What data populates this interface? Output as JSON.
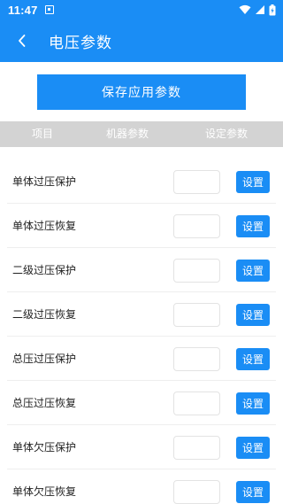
{
  "status_bar": {
    "time": "11:47",
    "icons": [
      "notification-icon",
      "wifi-icon",
      "signal-icon",
      "battery-charging-icon"
    ]
  },
  "app_bar": {
    "back_icon": "chevron-left-icon",
    "title": "电压参数"
  },
  "save_button": {
    "label": "保存应用参数"
  },
  "table": {
    "headers": [
      "项目",
      "机器参数",
      "设定参数"
    ],
    "rows": [
      {
        "label": "单体过压保护",
        "machine_value": "",
        "set_value": "",
        "button": "设置"
      },
      {
        "label": "单体过压恢复",
        "machine_value": "",
        "set_value": "",
        "button": "设置"
      },
      {
        "label": "二级过压保护",
        "machine_value": "",
        "set_value": "",
        "button": "设置"
      },
      {
        "label": "二级过压恢复",
        "machine_value": "",
        "set_value": "",
        "button": "设置"
      },
      {
        "label": "总压过压保护",
        "machine_value": "",
        "set_value": "",
        "button": "设置"
      },
      {
        "label": "总压过压恢复",
        "machine_value": "",
        "set_value": "",
        "button": "设置"
      },
      {
        "label": "单体欠压保护",
        "machine_value": "",
        "set_value": "",
        "button": "设置"
      },
      {
        "label": "单体欠压恢复",
        "machine_value": "",
        "set_value": "",
        "button": "设置"
      }
    ]
  },
  "colors": {
    "primary": "#1a8df5",
    "header_bg": "#d3d3d3",
    "text": "#222222"
  }
}
